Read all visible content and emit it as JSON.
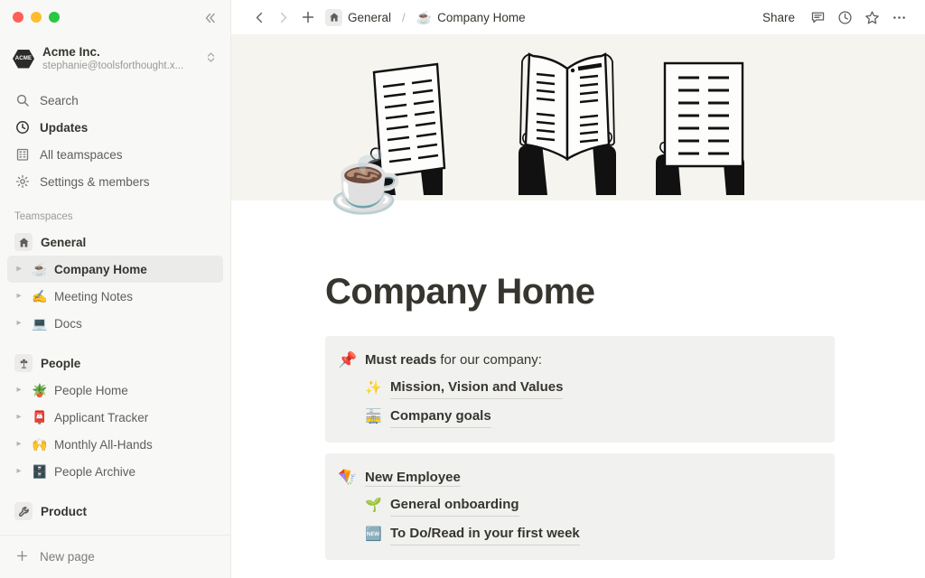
{
  "window": {
    "traffic_lights": [
      "close",
      "minimize",
      "maximize"
    ],
    "collapse_icon": "chevrons-left-icon"
  },
  "sidebar": {
    "workspace": {
      "logo_text": "ACME",
      "name": "Acme Inc.",
      "email": "stephanie@toolsforthought.x...",
      "switcher_icon": "chevron-updown-icon"
    },
    "nav": [
      {
        "icon": "search-icon",
        "label": "Search",
        "bold": false
      },
      {
        "icon": "clock-icon",
        "label": "Updates",
        "bold": true
      },
      {
        "icon": "building-icon",
        "label": "All teamspaces",
        "bold": false
      },
      {
        "icon": "gear-icon",
        "label": "Settings & members",
        "bold": false
      }
    ],
    "section_label": "Teamspaces",
    "teamspaces": [
      {
        "name": "General",
        "badge_icon": "house-icon",
        "pages": [
          {
            "emoji": "☕",
            "label": "Company Home",
            "selected": true
          },
          {
            "emoji": "✍️",
            "label": "Meeting Notes",
            "selected": false
          },
          {
            "emoji": "💻",
            "label": "Docs",
            "selected": false
          }
        ]
      },
      {
        "name": "People",
        "badge_icon": "flower-icon",
        "pages": [
          {
            "emoji": "🪴",
            "label": "People Home",
            "selected": false
          },
          {
            "emoji": "📮",
            "label": "Applicant Tracker",
            "selected": false
          },
          {
            "emoji": "🙌",
            "label": "Monthly All-Hands",
            "selected": false
          },
          {
            "emoji": "🗄️",
            "label": "People Archive",
            "selected": false
          }
        ]
      },
      {
        "name": "Product",
        "badge_icon": "wrench-icon",
        "pages": []
      }
    ],
    "footer": {
      "icon": "plus-icon",
      "label": "New page"
    }
  },
  "topbar": {
    "back_icon": "chevron-left-icon",
    "forward_icon": "chevron-right-icon",
    "new_icon": "plus-icon",
    "breadcrumb": {
      "teamspace": "General",
      "teamspace_icon": "house-icon",
      "separator": "/",
      "page_emoji": "☕",
      "page": "Company Home"
    },
    "share_label": "Share",
    "actions": [
      {
        "icon": "comment-icon"
      },
      {
        "icon": "clock-history-icon"
      },
      {
        "icon": "star-icon"
      },
      {
        "icon": "more-horizontal-icon"
      }
    ]
  },
  "page": {
    "cover_alt": "people-reading-newspapers-illustration",
    "cover_bg": "#f5f4ef",
    "icon_emoji": "☕",
    "title": "Company Home",
    "callouts": [
      {
        "emoji": "📌",
        "text_bold": "Must reads",
        "text_rest": " for our company:",
        "items": [
          {
            "emoji": "✨",
            "label": "Mission, Vision and Values"
          },
          {
            "emoji": "🚋",
            "label": "Company goals"
          }
        ]
      },
      {
        "emoji": "🪁",
        "link_label": "New Employee",
        "items": [
          {
            "emoji": "🌱",
            "label": "General onboarding"
          },
          {
            "emoji": "🆕",
            "label": "To Do/Read in your first week"
          }
        ]
      }
    ]
  },
  "colors": {
    "sidebar_bg": "#f8f8f7",
    "callout_bg": "#f1f1ef",
    "text": "#37352f",
    "muted": "#9b9a97",
    "selected_bg": "#ebebea"
  }
}
